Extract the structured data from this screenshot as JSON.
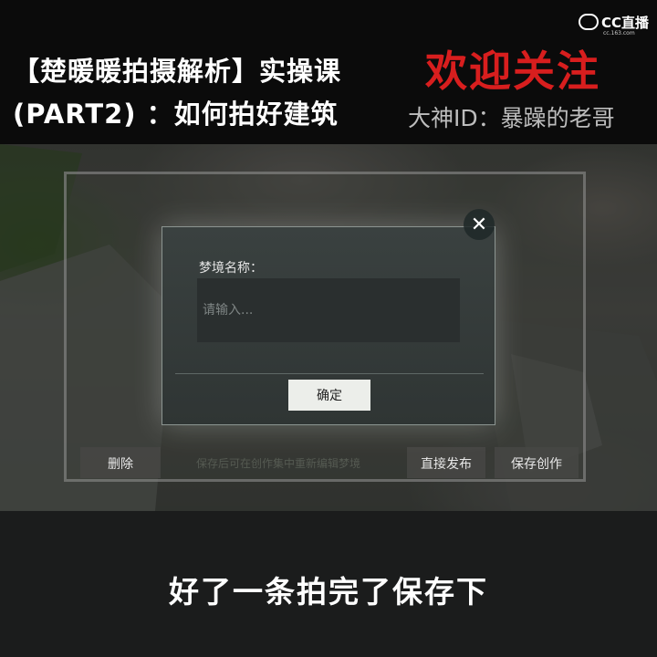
{
  "video_overlay": {
    "title_line1": "【楚暖暖拍摄解析】实操课",
    "title_line2": "(PART2) ：如何拍好建筑",
    "follow_text": "欢迎关注",
    "streamer_text": "大神ID：暴躁的老哥",
    "logo_text": "CC直播",
    "logo_url": "cc.163.com",
    "subtitle": "好了一条拍完了保存下",
    "follow_color": "#d81e1e"
  },
  "game_ui": {
    "bottom_bar": {
      "delete_label": "删除",
      "hint_text": "保存后可在创作集中重新编辑梦境",
      "publish_label": "直接发布",
      "save_label": "保存创作"
    },
    "dialog": {
      "label": "梦境名称：",
      "input_placeholder": "请输入...",
      "input_value": "",
      "confirm_label": "确定",
      "close_icon": "close-icon"
    }
  }
}
